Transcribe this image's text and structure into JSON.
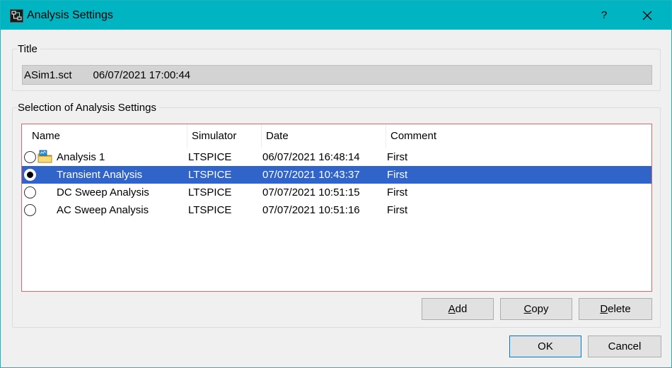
{
  "window": {
    "title": "Analysis Settings",
    "help_label": "?"
  },
  "title_group": {
    "label": "Title",
    "file_name": "ASim1.sct",
    "timestamp": "06/07/2021 17:00:44"
  },
  "selection_group": {
    "label": "Selection of Analysis Settings",
    "columns": [
      "Name",
      "Simulator",
      "Date",
      "Comment"
    ],
    "rows": [
      {
        "name": "Analysis 1",
        "simulator": "LTSPICE",
        "date": "06/07/2021 16:48:14",
        "comment": "First",
        "selected": false,
        "checked": false,
        "has_icon": true
      },
      {
        "name": "Transient Analysis",
        "simulator": "LTSPICE",
        "date": "07/07/2021 10:43:37",
        "comment": "First",
        "selected": true,
        "checked": true,
        "has_icon": false
      },
      {
        "name": "DC Sweep Analysis",
        "simulator": "LTSPICE",
        "date": "07/07/2021 10:51:15",
        "comment": "First",
        "selected": false,
        "checked": false,
        "has_icon": false
      },
      {
        "name": "AC Sweep Analysis",
        "simulator": "LTSPICE",
        "date": "07/07/2021 10:51:16",
        "comment": "First",
        "selected": false,
        "checked": false,
        "has_icon": false
      }
    ]
  },
  "buttons": {
    "add": {
      "accel": "A",
      "rest": "dd"
    },
    "copy": {
      "accel": "C",
      "rest": "opy"
    },
    "delete": {
      "accel": "D",
      "rest": "elete"
    },
    "ok": "OK",
    "cancel": "Cancel"
  },
  "colors": {
    "titlebar": "#00b4c2",
    "selection": "#3064c8",
    "list_border": "#e06666"
  },
  "icons": {
    "app": "analysis-app-icon",
    "close": "close-icon",
    "row_icon": "analysis-folder-icon"
  }
}
